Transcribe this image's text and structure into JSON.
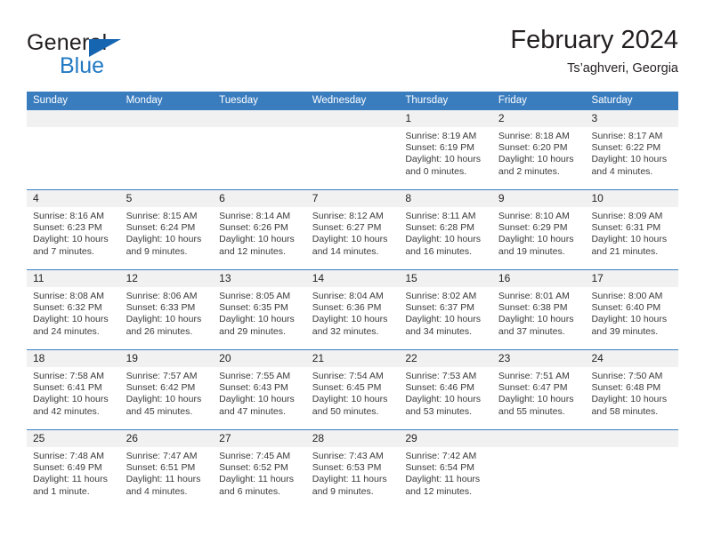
{
  "brand": {
    "word_one": "General",
    "word_two": "Blue",
    "triangle_color": "#1565b0",
    "blue_color": "#2179c4"
  },
  "header": {
    "title": "February 2024",
    "subtitle": "Ts’aghveri, Georgia"
  },
  "theme": {
    "header_row_bg": "#3a7dbf",
    "day_strip_bg": "#f1f1f1",
    "text_color": "#231f20",
    "info_text_color": "#3a3a3a"
  },
  "weekdays": [
    "Sunday",
    "Monday",
    "Tuesday",
    "Wednesday",
    "Thursday",
    "Friday",
    "Saturday"
  ],
  "weeks": [
    [
      {
        "day": "",
        "empty": true
      },
      {
        "day": "",
        "empty": true
      },
      {
        "day": "",
        "empty": true
      },
      {
        "day": "",
        "empty": true
      },
      {
        "day": "1",
        "sunrise": "Sunrise: 8:19 AM",
        "sunset": "Sunset: 6:19 PM",
        "daylight": "Daylight: 10 hours and 0 minutes."
      },
      {
        "day": "2",
        "sunrise": "Sunrise: 8:18 AM",
        "sunset": "Sunset: 6:20 PM",
        "daylight": "Daylight: 10 hours and 2 minutes."
      },
      {
        "day": "3",
        "sunrise": "Sunrise: 8:17 AM",
        "sunset": "Sunset: 6:22 PM",
        "daylight": "Daylight: 10 hours and 4 minutes."
      }
    ],
    [
      {
        "day": "4",
        "sunrise": "Sunrise: 8:16 AM",
        "sunset": "Sunset: 6:23 PM",
        "daylight": "Daylight: 10 hours and 7 minutes."
      },
      {
        "day": "5",
        "sunrise": "Sunrise: 8:15 AM",
        "sunset": "Sunset: 6:24 PM",
        "daylight": "Daylight: 10 hours and 9 minutes."
      },
      {
        "day": "6",
        "sunrise": "Sunrise: 8:14 AM",
        "sunset": "Sunset: 6:26 PM",
        "daylight": "Daylight: 10 hours and 12 minutes."
      },
      {
        "day": "7",
        "sunrise": "Sunrise: 8:12 AM",
        "sunset": "Sunset: 6:27 PM",
        "daylight": "Daylight: 10 hours and 14 minutes."
      },
      {
        "day": "8",
        "sunrise": "Sunrise: 8:11 AM",
        "sunset": "Sunset: 6:28 PM",
        "daylight": "Daylight: 10 hours and 16 minutes."
      },
      {
        "day": "9",
        "sunrise": "Sunrise: 8:10 AM",
        "sunset": "Sunset: 6:29 PM",
        "daylight": "Daylight: 10 hours and 19 minutes."
      },
      {
        "day": "10",
        "sunrise": "Sunrise: 8:09 AM",
        "sunset": "Sunset: 6:31 PM",
        "daylight": "Daylight: 10 hours and 21 minutes."
      }
    ],
    [
      {
        "day": "11",
        "sunrise": "Sunrise: 8:08 AM",
        "sunset": "Sunset: 6:32 PM",
        "daylight": "Daylight: 10 hours and 24 minutes."
      },
      {
        "day": "12",
        "sunrise": "Sunrise: 8:06 AM",
        "sunset": "Sunset: 6:33 PM",
        "daylight": "Daylight: 10 hours and 26 minutes."
      },
      {
        "day": "13",
        "sunrise": "Sunrise: 8:05 AM",
        "sunset": "Sunset: 6:35 PM",
        "daylight": "Daylight: 10 hours and 29 minutes."
      },
      {
        "day": "14",
        "sunrise": "Sunrise: 8:04 AM",
        "sunset": "Sunset: 6:36 PM",
        "daylight": "Daylight: 10 hours and 32 minutes."
      },
      {
        "day": "15",
        "sunrise": "Sunrise: 8:02 AM",
        "sunset": "Sunset: 6:37 PM",
        "daylight": "Daylight: 10 hours and 34 minutes."
      },
      {
        "day": "16",
        "sunrise": "Sunrise: 8:01 AM",
        "sunset": "Sunset: 6:38 PM",
        "daylight": "Daylight: 10 hours and 37 minutes."
      },
      {
        "day": "17",
        "sunrise": "Sunrise: 8:00 AM",
        "sunset": "Sunset: 6:40 PM",
        "daylight": "Daylight: 10 hours and 39 minutes."
      }
    ],
    [
      {
        "day": "18",
        "sunrise": "Sunrise: 7:58 AM",
        "sunset": "Sunset: 6:41 PM",
        "daylight": "Daylight: 10 hours and 42 minutes."
      },
      {
        "day": "19",
        "sunrise": "Sunrise: 7:57 AM",
        "sunset": "Sunset: 6:42 PM",
        "daylight": "Daylight: 10 hours and 45 minutes."
      },
      {
        "day": "20",
        "sunrise": "Sunrise: 7:55 AM",
        "sunset": "Sunset: 6:43 PM",
        "daylight": "Daylight: 10 hours and 47 minutes."
      },
      {
        "day": "21",
        "sunrise": "Sunrise: 7:54 AM",
        "sunset": "Sunset: 6:45 PM",
        "daylight": "Daylight: 10 hours and 50 minutes."
      },
      {
        "day": "22",
        "sunrise": "Sunrise: 7:53 AM",
        "sunset": "Sunset: 6:46 PM",
        "daylight": "Daylight: 10 hours and 53 minutes."
      },
      {
        "day": "23",
        "sunrise": "Sunrise: 7:51 AM",
        "sunset": "Sunset: 6:47 PM",
        "daylight": "Daylight: 10 hours and 55 minutes."
      },
      {
        "day": "24",
        "sunrise": "Sunrise: 7:50 AM",
        "sunset": "Sunset: 6:48 PM",
        "daylight": "Daylight: 10 hours and 58 minutes."
      }
    ],
    [
      {
        "day": "25",
        "sunrise": "Sunrise: 7:48 AM",
        "sunset": "Sunset: 6:49 PM",
        "daylight": "Daylight: 11 hours and 1 minute."
      },
      {
        "day": "26",
        "sunrise": "Sunrise: 7:47 AM",
        "sunset": "Sunset: 6:51 PM",
        "daylight": "Daylight: 11 hours and 4 minutes."
      },
      {
        "day": "27",
        "sunrise": "Sunrise: 7:45 AM",
        "sunset": "Sunset: 6:52 PM",
        "daylight": "Daylight: 11 hours and 6 minutes."
      },
      {
        "day": "28",
        "sunrise": "Sunrise: 7:43 AM",
        "sunset": "Sunset: 6:53 PM",
        "daylight": "Daylight: 11 hours and 9 minutes."
      },
      {
        "day": "29",
        "sunrise": "Sunrise: 7:42 AM",
        "sunset": "Sunset: 6:54 PM",
        "daylight": "Daylight: 11 hours and 12 minutes."
      },
      {
        "day": "",
        "empty": true
      },
      {
        "day": "",
        "empty": true
      }
    ]
  ]
}
